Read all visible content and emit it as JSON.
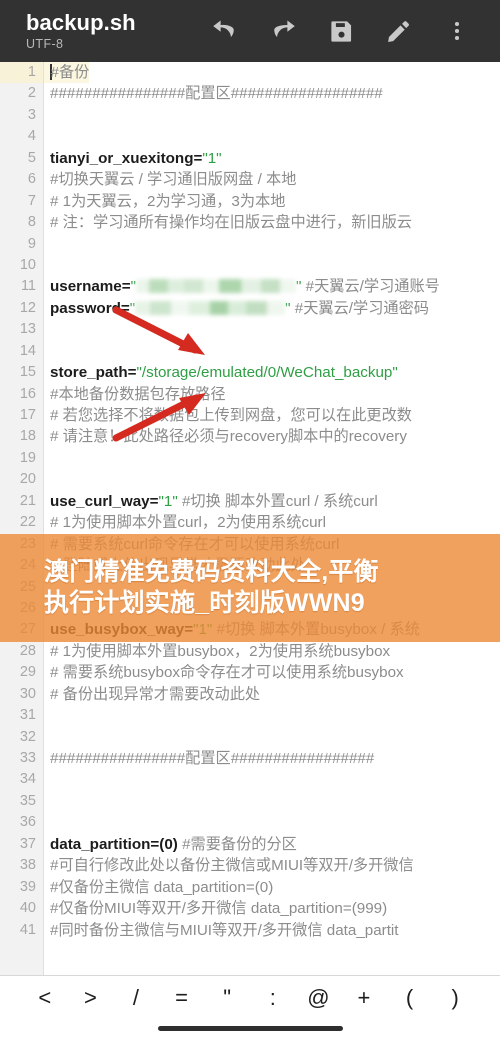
{
  "header": {
    "file_name": "backup.sh",
    "encoding": "UTF-8",
    "actions": [
      {
        "name": "undo-button",
        "icon": "undo-icon",
        "label": "Undo"
      },
      {
        "name": "redo-button",
        "icon": "redo-icon",
        "label": "Redo"
      },
      {
        "name": "save-button",
        "icon": "save-floppy-icon",
        "label": "Save"
      },
      {
        "name": "edit-button",
        "icon": "pencil-icon",
        "label": "Edit"
      },
      {
        "name": "overflow-menu-button",
        "icon": "three-dots-vertical-icon",
        "label": "More options"
      }
    ]
  },
  "editor": {
    "current_line": 1,
    "lines": [
      {
        "n": "1",
        "parts": [
          {
            "t": "caret",
            "v": ""
          },
          {
            "t": "cm",
            "v": "#备份"
          }
        ]
      },
      {
        "n": "2",
        "parts": [
          {
            "t": "cm",
            "v": "################配置区##################"
          }
        ]
      },
      {
        "n": "3",
        "parts": []
      },
      {
        "n": "4",
        "parts": []
      },
      {
        "n": "5",
        "parts": [
          {
            "t": "var",
            "v": "tianyi_or_xuexitong="
          },
          {
            "t": "str",
            "v": "\"1\""
          }
        ]
      },
      {
        "n": "6",
        "parts": [
          {
            "t": "cm",
            "v": "#切换天翼云 / 学习通旧版网盘 / 本地"
          }
        ]
      },
      {
        "n": "7",
        "parts": [
          {
            "t": "cm",
            "v": "# 1为天翼云，2为学习通，3为本地"
          }
        ]
      },
      {
        "n": "8",
        "parts": [
          {
            "t": "cm",
            "v": "# 注：学习通所有操作均在旧版云盘中进行，新旧版云"
          }
        ]
      },
      {
        "n": "9",
        "parts": []
      },
      {
        "n": "10",
        "parts": []
      },
      {
        "n": "11",
        "parts": [
          {
            "t": "var",
            "v": "username="
          },
          {
            "t": "str",
            "v": "\""
          },
          {
            "t": "redact",
            "v": ""
          },
          {
            "t": "str",
            "v": "\""
          },
          {
            "t": "cm",
            "v": " #天翼云/学习通账号"
          }
        ]
      },
      {
        "n": "12",
        "parts": [
          {
            "t": "var",
            "v": "password="
          },
          {
            "t": "str",
            "v": "\""
          },
          {
            "t": "redactb",
            "v": ""
          },
          {
            "t": "str",
            "v": "\""
          },
          {
            "t": "cm",
            "v": " #天翼云/学习通密码"
          }
        ]
      },
      {
        "n": "13",
        "parts": []
      },
      {
        "n": "14",
        "parts": []
      },
      {
        "n": "15",
        "parts": [
          {
            "t": "var",
            "v": "store_path="
          },
          {
            "t": "str",
            "v": "\"/storage/emulated/0/WeChat_backup\""
          }
        ]
      },
      {
        "n": "16",
        "parts": [
          {
            "t": "cm",
            "v": "#本地备份数据包存放路径"
          }
        ]
      },
      {
        "n": "17",
        "parts": [
          {
            "t": "cm",
            "v": "# 若您选择不将数据包上传到网盘，您可以在此更改数"
          }
        ]
      },
      {
        "n": "18",
        "parts": [
          {
            "t": "cm",
            "v": "# 请注意！此处路径必须与recovery脚本中的recovery"
          }
        ]
      },
      {
        "n": "19",
        "parts": []
      },
      {
        "n": "20",
        "parts": []
      },
      {
        "n": "21",
        "parts": [
          {
            "t": "var",
            "v": "use_curl_way="
          },
          {
            "t": "str",
            "v": "\"1\""
          },
          {
            "t": "cm",
            "v": " #切换 脚本外置curl / 系统curl"
          }
        ]
      },
      {
        "n": "22",
        "parts": [
          {
            "t": "cm",
            "v": "# 1为使用脚本外置curl，2为使用系统curl"
          }
        ]
      },
      {
        "n": "23",
        "parts": [
          {
            "t": "cm",
            "v": "# 需要系统curl命令存在才可以使用系统curl"
          }
        ]
      },
      {
        "n": "24",
        "parts": [
          {
            "t": "cm",
            "v": "# 登陆或上传出现异常才需要改动此处"
          }
        ]
      },
      {
        "n": "25",
        "parts": []
      },
      {
        "n": "26",
        "parts": []
      },
      {
        "n": "27",
        "parts": [
          {
            "t": "var",
            "v": "use_busybox_way="
          },
          {
            "t": "str",
            "v": "\"1\""
          },
          {
            "t": "cm",
            "v": " #切换 脚本外置busybox / 系统"
          }
        ]
      },
      {
        "n": "28",
        "parts": [
          {
            "t": "cm",
            "v": "# 1为使用脚本外置busybox，2为使用系统busybox"
          }
        ]
      },
      {
        "n": "29",
        "parts": [
          {
            "t": "cm",
            "v": "# 需要系统busybox命令存在才可以使用系统busybox"
          }
        ]
      },
      {
        "n": "30",
        "parts": [
          {
            "t": "cm",
            "v": "# 备份出现异常才需要改动此处"
          }
        ]
      },
      {
        "n": "31",
        "parts": []
      },
      {
        "n": "32",
        "parts": []
      },
      {
        "n": "33",
        "parts": [
          {
            "t": "cm",
            "v": "################配置区#################"
          }
        ]
      },
      {
        "n": "34",
        "parts": []
      },
      {
        "n": "35",
        "parts": []
      },
      {
        "n": "36",
        "parts": []
      },
      {
        "n": "37",
        "parts": [
          {
            "t": "var",
            "v": "data_partition=(0)"
          },
          {
            "t": "cm",
            "v": "  #需要备份的分区"
          }
        ]
      },
      {
        "n": "38",
        "parts": [
          {
            "t": "cm",
            "v": "#可自行修改此处以备份主微信或MIUI等双开/多开微信"
          }
        ]
      },
      {
        "n": "39",
        "parts": [
          {
            "t": "cm",
            "v": "#仅备份主微信  data_partition=(0)"
          }
        ]
      },
      {
        "n": "40",
        "parts": [
          {
            "t": "cm",
            "v": "#仅备份MIUI等双开/多开微信  data_partition=(999)"
          }
        ]
      },
      {
        "n": "41",
        "parts": [
          {
            "t": "cm",
            "v": "#同时备份主微信与MIUI等双开/多开微信  data_partit"
          }
        ]
      }
    ]
  },
  "watermark": {
    "line1": "澳门精准免费码资料大全,平衡",
    "line2": "执行计划实施_时刻版WWN9",
    "color": "#ed8936"
  },
  "annotations": {
    "arrow_color": "#d42a1f",
    "arrow_targets": [
      "username-value",
      "password-value"
    ]
  },
  "bottom_toolbar": {
    "symbols": [
      "<",
      ">",
      "/",
      "=",
      "\"",
      ":",
      "@",
      "+",
      "(",
      ")"
    ]
  }
}
